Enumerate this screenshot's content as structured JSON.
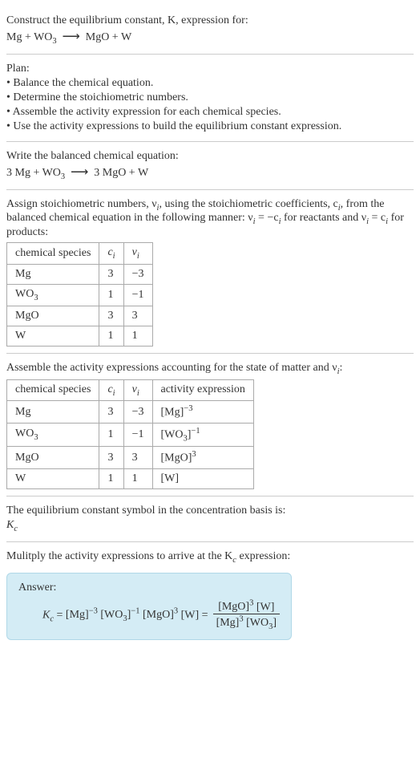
{
  "header": {
    "line1": "Construct the equilibrium constant, K, expression for:",
    "eq_lhs": "Mg + WO",
    "eq_sub1": "3",
    "arrow": "⟶",
    "eq_rhs": "MgO + W"
  },
  "plan": {
    "title": "Plan:",
    "items": [
      "• Balance the chemical equation.",
      "• Determine the stoichiometric numbers.",
      "• Assemble the activity expression for each chemical species.",
      "• Use the activity expressions to build the equilibrium constant expression."
    ]
  },
  "balanced": {
    "intro": "Write the balanced chemical equation:",
    "lhs1": "3 Mg + WO",
    "sub1": "3",
    "arrow": "⟶",
    "rhs": "3 MgO + W"
  },
  "stoich": {
    "intro1": "Assign stoichiometric numbers, ν",
    "intro1b": ", using the stoichiometric coefficients, c",
    "intro1c": ", from the balanced chemical equation in the following manner: ν",
    "intro1d": " = −c",
    "intro1e": " for reactants and ν",
    "intro1f": " = c",
    "intro1g": " for products:",
    "headers": [
      "chemical species",
      "cᵢ",
      "νᵢ"
    ],
    "rows": [
      [
        "Mg",
        "3",
        "−3"
      ],
      [
        "WO₃",
        "1",
        "−1"
      ],
      [
        "MgO",
        "3",
        "3"
      ],
      [
        "W",
        "1",
        "1"
      ]
    ]
  },
  "activity": {
    "intro": "Assemble the activity expressions accounting for the state of matter and ν",
    "intro_end": ":",
    "headers": [
      "chemical species",
      "cᵢ",
      "νᵢ",
      "activity expression"
    ],
    "rows": [
      {
        "sp": "Mg",
        "c": "3",
        "v": "−3",
        "ae_base": "[Mg]",
        "ae_sup": "−3"
      },
      {
        "sp": "WO₃",
        "c": "1",
        "v": "−1",
        "ae_base": "[WO₃]",
        "ae_sup": "−1"
      },
      {
        "sp": "MgO",
        "c": "3",
        "v": "3",
        "ae_base": "[MgO]",
        "ae_sup": "3"
      },
      {
        "sp": "W",
        "c": "1",
        "v": "1",
        "ae_base": "[W]",
        "ae_sup": ""
      }
    ]
  },
  "symbol": {
    "line1": "The equilibrium constant symbol in the concentration basis is:",
    "kc": "K",
    "kc_sub": "c"
  },
  "final": {
    "intro": "Mulitply the activity expressions to arrive at the K",
    "intro_sub": "c",
    "intro_end": " expression:",
    "answer_label": "Answer:",
    "kc": "K",
    "kc_sub": "c",
    "eq": " = ",
    "t1": "[Mg]",
    "t1s": "−3",
    "t2": "[WO₃]",
    "t2s": "−1",
    "t3": "[MgO]",
    "t3s": "3",
    "t4": "[W]",
    "eq2": " = ",
    "num1": "[MgO]",
    "num1s": "3",
    "num2": "[W]",
    "den1": "[Mg]",
    "den1s": "3",
    "den2": "[WO₃]"
  },
  "chart_data": {
    "type": "table",
    "tables": [
      {
        "title": "stoichiometric numbers",
        "columns": [
          "chemical species",
          "c_i",
          "nu_i"
        ],
        "rows": [
          [
            "Mg",
            3,
            -3
          ],
          [
            "WO3",
            1,
            -1
          ],
          [
            "MgO",
            3,
            3
          ],
          [
            "W",
            1,
            1
          ]
        ]
      },
      {
        "title": "activity expressions",
        "columns": [
          "chemical species",
          "c_i",
          "nu_i",
          "activity expression"
        ],
        "rows": [
          [
            "Mg",
            3,
            -3,
            "[Mg]^-3"
          ],
          [
            "WO3",
            1,
            -1,
            "[WO3]^-1"
          ],
          [
            "MgO",
            3,
            3,
            "[MgO]^3"
          ],
          [
            "W",
            1,
            1,
            "[W]"
          ]
        ]
      }
    ]
  }
}
